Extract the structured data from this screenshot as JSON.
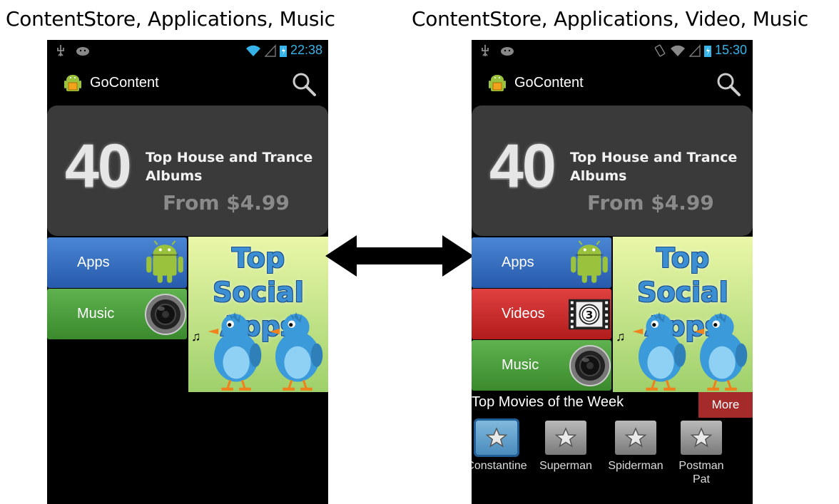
{
  "captions": {
    "left": "ContentStore, Applications, Music",
    "right": "ContentStore, Applications, Video, Music"
  },
  "colors": {
    "clock": "#36b3e8",
    "apps_tile": "#3569bd",
    "music_tile": "#4a9a3b",
    "videos_tile": "#c62a2a",
    "promo_bg": "#3a3a3a",
    "more_button": "#a52a2a"
  },
  "left_phone": {
    "status": {
      "time": "22:38",
      "icons": [
        "usb-icon",
        "android-debug-icon",
        "wifi-icon",
        "signal-icon",
        "battery-charging-icon"
      ]
    },
    "action_bar": {
      "title": "GoContent",
      "search_icon": "search-icon"
    },
    "promo": {
      "number": "40",
      "text": "Top House and Trance Albums",
      "price": "From $4.99"
    },
    "tiles": [
      {
        "label": "Apps",
        "icon": "android-icon"
      },
      {
        "label": "Music",
        "icon": "speaker-icon"
      }
    ],
    "social": {
      "line1": "Top Social",
      "line2": "Apps"
    }
  },
  "right_phone": {
    "status": {
      "time": "15:30",
      "icons": [
        "usb-icon",
        "android-debug-icon",
        "rotate-icon",
        "wifi-icon",
        "signal-icon",
        "battery-charging-icon"
      ]
    },
    "action_bar": {
      "title": "GoContent",
      "search_icon": "search-icon"
    },
    "promo": {
      "number": "40",
      "text": "Top House and Trance Albums",
      "price": "From $4.99"
    },
    "tiles": [
      {
        "label": "Apps",
        "icon": "android-icon"
      },
      {
        "label": "Videos",
        "icon": "film-countdown-icon"
      },
      {
        "label": "Music",
        "icon": "speaker-icon"
      }
    ],
    "social": {
      "line1": "Top Social",
      "line2": "Apps"
    },
    "movies": {
      "title": "Top Movies of the Week",
      "more": "More",
      "items": [
        {
          "label": "Constantine",
          "selected": true
        },
        {
          "label": "Superman",
          "selected": false
        },
        {
          "label": "Spiderman",
          "selected": false
        },
        {
          "label": "Postman Pat",
          "selected": false
        }
      ]
    }
  }
}
